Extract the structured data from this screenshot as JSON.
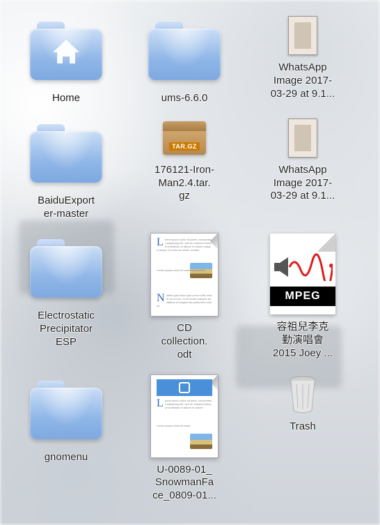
{
  "icons": {
    "home": {
      "label": "Home"
    },
    "ums": {
      "label": "ums-6.6.0"
    },
    "whatsapp1": {
      "label": "WhatsApp\nImage 2017-\n03-29 at 9.1..."
    },
    "baidu": {
      "label": "BaiduExport\ner-master"
    },
    "ironman": {
      "label": "176121-Iron-\nMan2.4.tar.\ngz",
      "badge": "TAR.GZ"
    },
    "whatsapp2": {
      "label": "WhatsApp\nImage 2017-\n03-29 at 9.1..."
    },
    "esp": {
      "label": "Electrostatic\nPrecipitator\nESP"
    },
    "cdcoll": {
      "label": "CD\ncollection.\nodt"
    },
    "mpeg": {
      "label": "容祖兒李克\n勤演唱會\n2015 Joey ...",
      "band": "MPEG"
    },
    "gnomenu": {
      "label": "gnomenu"
    },
    "snowman": {
      "label": "U-0089-01_\nSnowmanFa\nce_0809-01..."
    },
    "trash": {
      "label": "Trash"
    }
  },
  "colors": {
    "folder_top": "#c9ddf6",
    "folder_bottom": "#7ea9e0",
    "mpeg_wave": "#e11b1b",
    "doc_accent": "#4a90d9"
  }
}
